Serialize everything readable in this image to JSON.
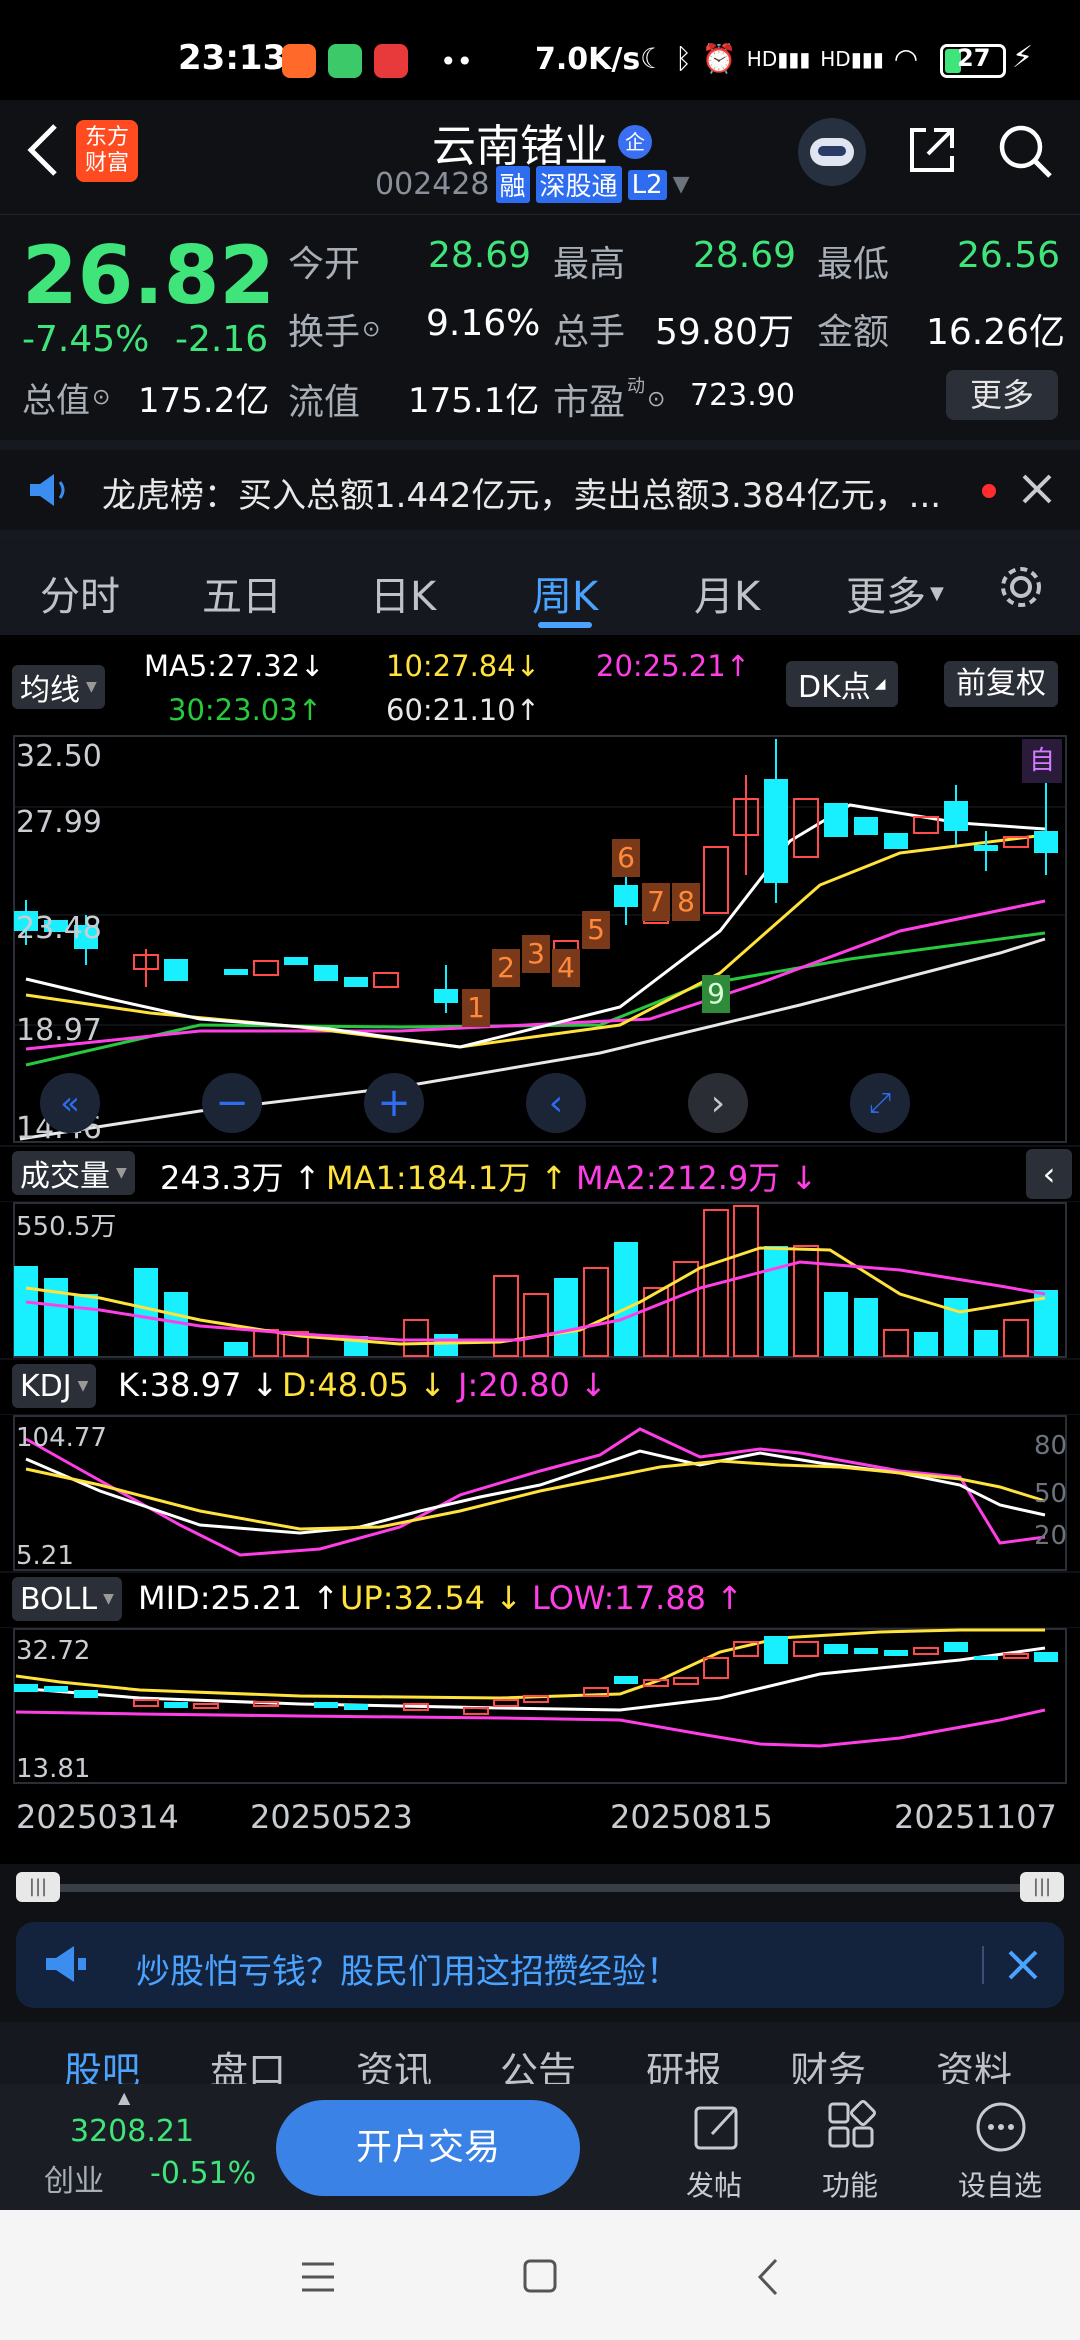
{
  "status_bar": {
    "time": "23:13",
    "net_speed": "7.0K/s",
    "battery": "27"
  },
  "header": {
    "logo_text": "东方\n财富",
    "title": "云南锗业",
    "badge_text": "企",
    "code": "002428",
    "tags": [
      "融",
      "深股通",
      "L2"
    ]
  },
  "quote": {
    "price": "26.82",
    "change_pct": "-7.45%",
    "change_val": "-2.16",
    "stats_row1": [
      {
        "label": "今开",
        "value": "28.69"
      },
      {
        "label": "最高",
        "value": "28.69"
      },
      {
        "label": "最低",
        "value": "26.56"
      }
    ],
    "stats_row2": [
      {
        "label": "换手",
        "value": "9.16%"
      },
      {
        "label": "总手",
        "value": "59.80万"
      },
      {
        "label": "金额",
        "value": "16.26亿"
      }
    ],
    "stats_row3": [
      {
        "label": "总值",
        "value": "175.2亿"
      },
      {
        "label": "流值",
        "value": "175.1亿"
      },
      {
        "label": "市盈",
        "value": "723.90"
      }
    ],
    "more_btn": "更多"
  },
  "notice": {
    "text": "龙虎榜：买入总额1.442亿元，卖出总额3.384亿元，..."
  },
  "period_tabs": [
    "分时",
    "五日",
    "日K",
    "周K",
    "月K",
    "更多"
  ],
  "period_active_index": 3,
  "ma_legend": {
    "dropdown": "均线",
    "ma5": "MA5:27.32",
    "ma10": "10:27.84",
    "ma20": "20:25.21",
    "ma30": "30:23.03",
    "ma60": "60:21.10",
    "dk_btn": "DK点",
    "fq_btn": "前复权"
  },
  "main_chart": {
    "y_labels": [
      "32.50",
      "27.99",
      "23.48",
      "18.97",
      "14.46"
    ],
    "self_tag": "自",
    "markers": [
      "1",
      "2",
      "3",
      "4",
      "5",
      "6",
      "7",
      "8",
      "9"
    ]
  },
  "volume_panel": {
    "dropdown": "成交量",
    "value": "243.3万",
    "ma1": "MA1:184.1万",
    "ma2": "MA2:212.9万",
    "max_label": "550.5万"
  },
  "kdj_panel": {
    "dropdown": "KDJ",
    "k": "K:38.97",
    "d": "D:48.05",
    "j": "J:20.80",
    "top": "104.77",
    "bottom": "5.21",
    "lv80": "80",
    "lv50": "50",
    "lv20": "20"
  },
  "boll_panel": {
    "dropdown": "BOLL",
    "mid": "MID:25.21",
    "up": "UP:32.54",
    "low": "LOW:17.88",
    "top": "32.72",
    "bottom": "13.81"
  },
  "dates": [
    "20250314",
    "20250523",
    "20250815",
    "20251107"
  ],
  "ad_banner": {
    "text": "炒股怕亏钱？股民们用这招攒经验！"
  },
  "bottom_tabs": [
    "股吧",
    "盘口",
    "资讯",
    "公告",
    "研报",
    "财务",
    "资料"
  ],
  "bottom_bar": {
    "index_value": "3208.21",
    "index_name": "创业",
    "index_change": "-0.51%",
    "trade_btn": "开户交易",
    "post_label": "发帖",
    "func_label": "功能",
    "watch_label": "设自选"
  },
  "colors": {
    "up": "#ff4b4b",
    "down": "#19f0ff",
    "green_text": "#3fe47a",
    "accent_blue": "#4aa3ff"
  }
}
